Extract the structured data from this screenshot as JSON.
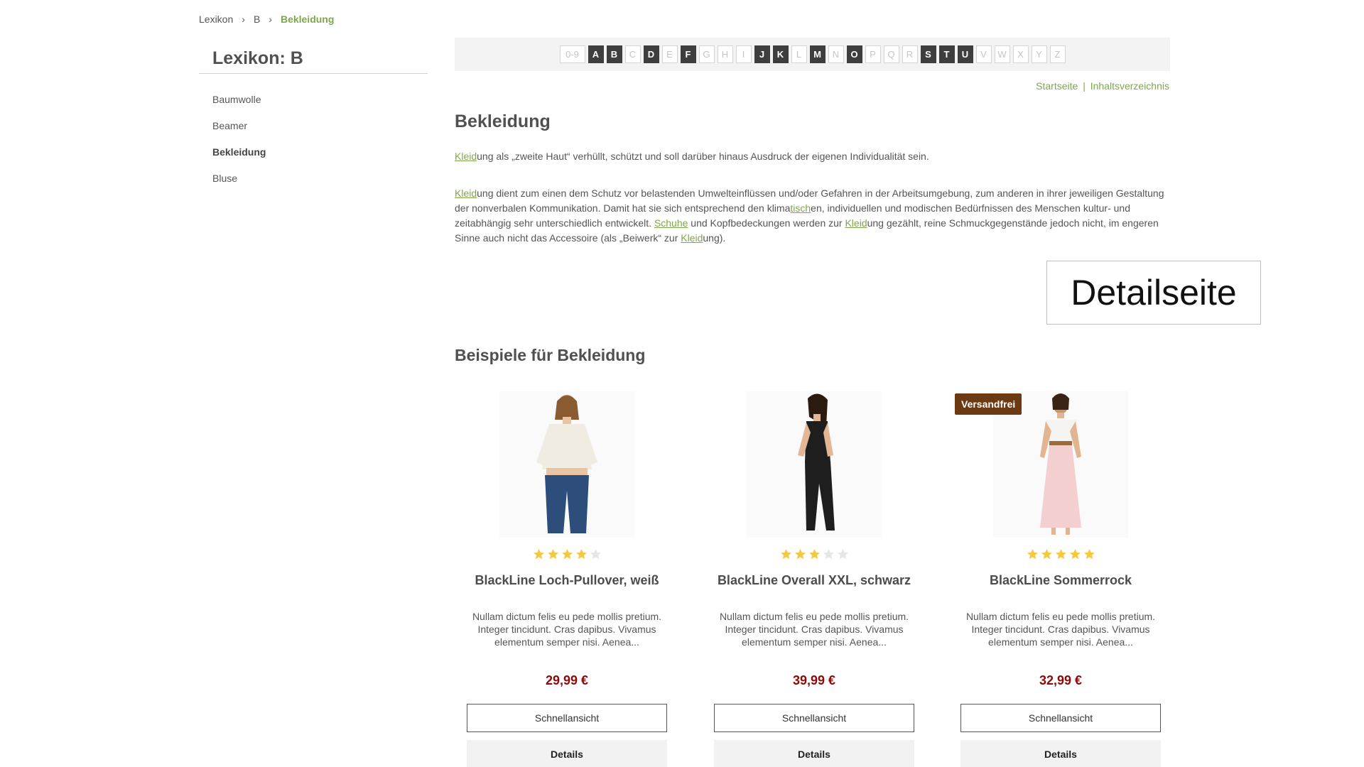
{
  "breadcrumb": {
    "items": [
      "Lexikon",
      "B",
      "Bekleidung"
    ]
  },
  "sidebar": {
    "title": "Lexikon: B",
    "items": [
      {
        "label": "Baumwolle",
        "active": false
      },
      {
        "label": "Beamer",
        "active": false
      },
      {
        "label": "Bekleidung",
        "active": true
      },
      {
        "label": "Bluse",
        "active": false
      }
    ]
  },
  "letters": [
    {
      "l": "0-9",
      "on": false
    },
    {
      "l": "A",
      "on": true
    },
    {
      "l": "B",
      "on": true
    },
    {
      "l": "C",
      "on": false
    },
    {
      "l": "D",
      "on": true
    },
    {
      "l": "E",
      "on": false
    },
    {
      "l": "F",
      "on": true
    },
    {
      "l": "G",
      "on": false
    },
    {
      "l": "H",
      "on": false
    },
    {
      "l": "I",
      "on": false
    },
    {
      "l": "J",
      "on": true
    },
    {
      "l": "K",
      "on": true
    },
    {
      "l": "L",
      "on": false
    },
    {
      "l": "M",
      "on": true
    },
    {
      "l": "N",
      "on": false
    },
    {
      "l": "O",
      "on": true
    },
    {
      "l": "P",
      "on": false
    },
    {
      "l": "Q",
      "on": false
    },
    {
      "l": "R",
      "on": false
    },
    {
      "l": "S",
      "on": true
    },
    {
      "l": "T",
      "on": true
    },
    {
      "l": "U",
      "on": true
    },
    {
      "l": "V",
      "on": false
    },
    {
      "l": "W",
      "on": false
    },
    {
      "l": "X",
      "on": false
    },
    {
      "l": "Y",
      "on": false
    },
    {
      "l": "Z",
      "on": false
    }
  ],
  "toplinks": {
    "home": "Startseite",
    "separator": "|",
    "index": "Inhaltsverzeichnis"
  },
  "article": {
    "title": "Bekleidung",
    "para1": [
      {
        "t": "Kleid",
        "link": true
      },
      {
        "t": "ung als „zweite Haut“ verhüllt, schützt und soll darüber hinaus Ausdruck der eigenen Individualität sein.",
        "link": false
      }
    ],
    "para2": [
      {
        "t": "Kleid",
        "link": true
      },
      {
        "t": "ung dient zum einen dem Schutz vor belastenden Umwelteinflüssen und/oder Gefahren in der Arbeitsumgebung, zum anderen in ihrer jeweiligen Gestaltung der nonverbalen Kommunikation. Damit hat sie sich entsprechend den klima",
        "link": false
      },
      {
        "t": "tisch",
        "link": true
      },
      {
        "t": "en, individuellen und modischen Bedürfnissen des Menschen kultur- und zeitabhängig sehr unterschiedlich entwickelt. ",
        "link": false
      },
      {
        "t": "Schuhe",
        "link": true
      },
      {
        "t": " und Kopfbedeckungen werden zur ",
        "link": false
      },
      {
        "t": "Kleid",
        "link": true
      },
      {
        "t": "ung gezählt, reine Schmuckgegenstände jedoch nicht, im engeren Sinne auch nicht das Accessoire (als „Beiwerk“ zur ",
        "link": false
      },
      {
        "t": "Kleid",
        "link": true
      },
      {
        "t": "ung).",
        "link": false
      }
    ],
    "detail_box": "Detailseite",
    "examples_title": "Beispiele für Bekleidung"
  },
  "colors": {
    "accent": "#7ea74a",
    "price": "#8b0a0a",
    "star": "#f5c842",
    "star_empty": "#e6e6e6",
    "badge": "#6b3a12"
  },
  "products": [
    {
      "name": "BlackLine Loch-Pullover, weiß",
      "rating": 4,
      "desc": "Nullam dictum felis eu pede mollis pretium. Integer tincidunt. Cras dapibus. Vivamus elementum semper nisi. Aenea...",
      "price": "29,99 €",
      "badge": "",
      "quick": "Schnellansicht",
      "details": "Details",
      "image": "woman-white-sweater-jeans"
    },
    {
      "name": "BlackLine Overall XXL, schwarz",
      "rating": 3,
      "desc": "Nullam dictum felis eu pede mollis pretium. Integer tincidunt. Cras dapibus. Vivamus elementum semper nisi. Aenea...",
      "price": "39,99 €",
      "badge": "",
      "quick": "Schnellansicht",
      "details": "Details",
      "image": "woman-black-overall"
    },
    {
      "name": "BlackLine Sommerrock",
      "rating": 5,
      "desc": "Nullam dictum felis eu pede mollis pretium. Integer tincidunt. Cras dapibus. Vivamus elementum semper nisi. Aenea...",
      "price": "32,99 €",
      "badge": "Versandfrei",
      "quick": "Schnellansicht",
      "details": "Details",
      "image": "woman-pink-summer-skirt"
    }
  ]
}
